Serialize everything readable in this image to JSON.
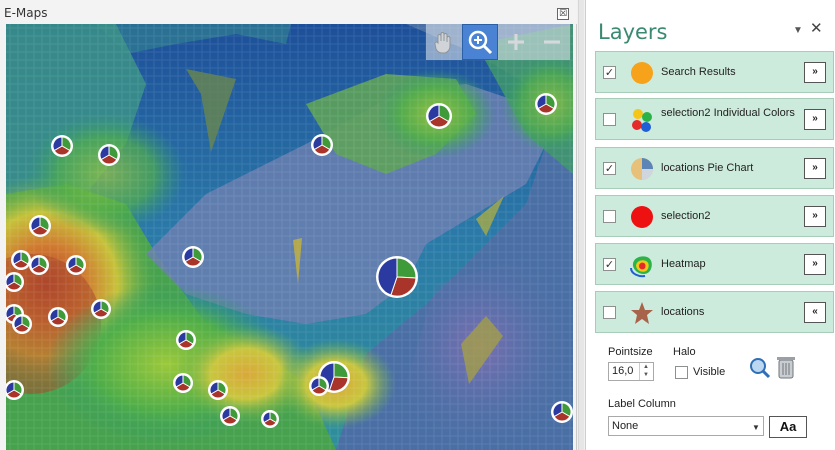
{
  "window": {
    "title": "E-Maps",
    "close_glyph": "☒"
  },
  "map": {
    "tools": [
      {
        "name": "hand-pan-tool",
        "icon": "hand-icon"
      },
      {
        "name": "zoom-tool",
        "icon": "magnifier-plus-icon",
        "active": true
      },
      {
        "name": "zoom-in",
        "icon": "plus-icon"
      },
      {
        "name": "zoom-out",
        "icon": "minus-icon"
      }
    ],
    "pie_colors": {
      "blue": "#2b3aa0",
      "red": "#a8342a",
      "green": "#3f9a3a"
    }
  },
  "layers_panel": {
    "title": "Layers",
    "pin_glyph": "▼",
    "close_glyph": "✕",
    "layers": [
      {
        "label": "Search Results",
        "checked": true,
        "icon": "orange-circle-icon",
        "expand": "»"
      },
      {
        "label": "selection2 Individual Colors",
        "checked": false,
        "icon": "multicolor-dots-icon",
        "expand": "»"
      },
      {
        "label": "locations Pie Chart",
        "checked": true,
        "icon": "pie-chart-icon",
        "expand": "»"
      },
      {
        "label": "selection2",
        "checked": false,
        "icon": "red-circle-icon",
        "expand": "»"
      },
      {
        "label": "Heatmap",
        "checked": true,
        "icon": "heatmap-icon",
        "expand": "»"
      },
      {
        "label": "locations",
        "checked": false,
        "icon": "star-icon",
        "expand": "«"
      }
    ],
    "options": {
      "pointsize_label": "Pointsize",
      "pointsize_value": "16,0",
      "halo_label": "Halo",
      "visible_label": "Visible",
      "visible_checked": false,
      "label_column_label": "Label Column",
      "label_column_value": "None",
      "font_button_label": "Aa"
    },
    "check_glyph": "✓"
  },
  "colors": {
    "accent": "#3a8a72",
    "layer_row_bg": "#cdebdc",
    "zoom_tool_active": "#4a83d4"
  }
}
